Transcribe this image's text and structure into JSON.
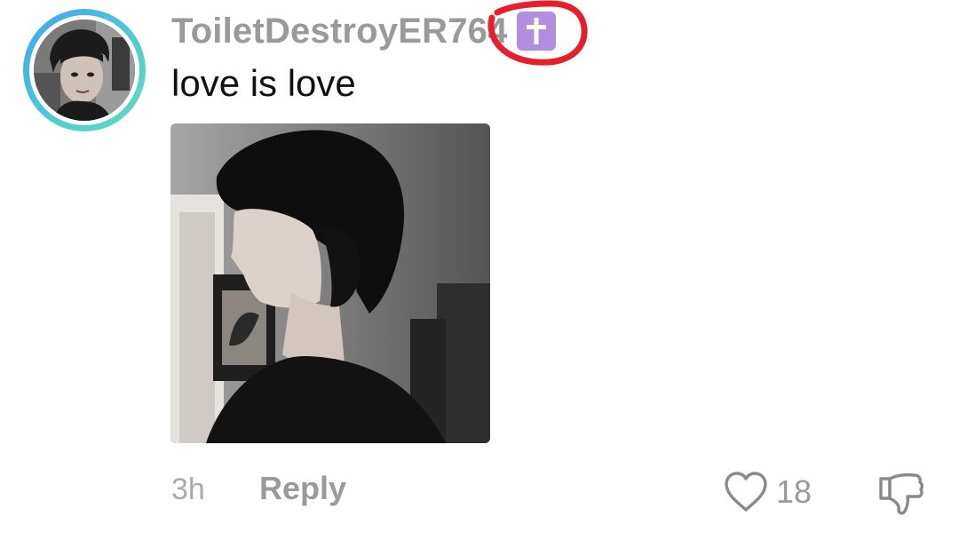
{
  "comment": {
    "username": "ToiletDestroyER764",
    "badge_icon": "latin-cross-icon",
    "badge_color": "#b38ee0",
    "highlight_color": "#e5202a",
    "text": "love is love",
    "timestamp": "3h",
    "reply_label": "Reply",
    "like_count": "18",
    "like_icon": "heart-outline-icon",
    "dislike_icon": "thumbs-down-icon",
    "avatar_ring_colors": [
      "#3fa4f0",
      "#5fe0b8"
    ]
  }
}
